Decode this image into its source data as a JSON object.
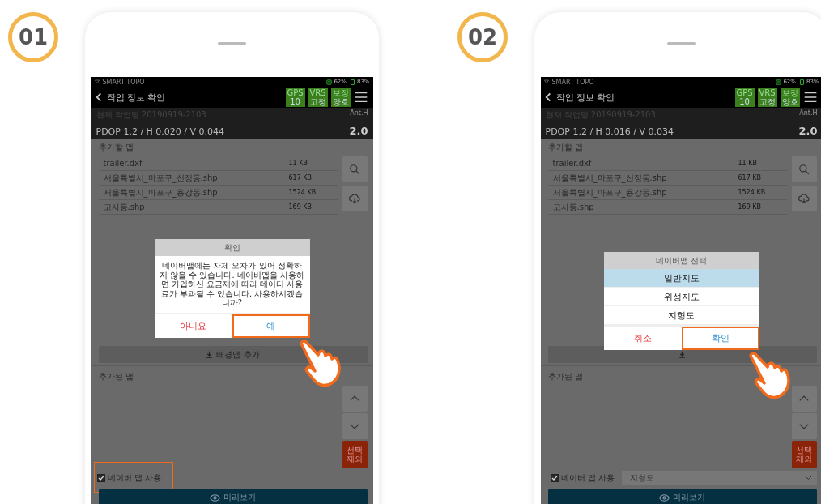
{
  "steps": [
    {
      "number": "01",
      "phone": {
        "status_bar": {
          "app_name": "SMART TOPO",
          "signal": "62%",
          "battery": "83%"
        },
        "header": {
          "title": "작업 정보 확인",
          "badges": [
            {
              "label": "GPS",
              "value": "10"
            },
            {
              "label": "VRS",
              "value": "고정"
            },
            {
              "label": "보정",
              "value": "양호"
            }
          ]
        },
        "info": {
          "job": "현재 작업명 20190919-2103",
          "precision": "PDOP 1.2 / H 0.020 / V 0.044",
          "ant_label": "Ant.H",
          "ant_value": "2.0"
        },
        "maps_to_add": {
          "label": "추가할 맵",
          "files": [
            {
              "name": "trailer.dxf",
              "size": "11 KB"
            },
            {
              "name": "서울특별시_마포구_신정동.shp",
              "size": "617 KB"
            },
            {
              "name": "서울특별시_마포구_용강동.shp",
              "size": "1524 KB"
            },
            {
              "name": "고사동.shp",
              "size": "169 KB"
            }
          ]
        },
        "add_background_button": "배경맵 추가",
        "added_maps": {
          "label": "추가된 맵",
          "exclude_button": "선택 제외"
        },
        "naver_checkbox": {
          "label": "네이버 맵 사용",
          "checked": true,
          "highlighted": true
        },
        "preview_button": "미리보기",
        "dialog": {
          "kind": "confirm",
          "title": "확인",
          "message": "네이버맵에는 자체 오차가 있어 정확하지 않을 수 있습니다. 네이버맵을 사용하면 가입하신 요금제에 따라 데이터 사용료가 부과될 수 있습니다. 사용하시겠습니까?",
          "buttons": [
            {
              "label": "아니요",
              "kind": "cancel",
              "highlighted": false
            },
            {
              "label": "예",
              "kind": "ok",
              "highlighted": true
            }
          ]
        }
      }
    },
    {
      "number": "02",
      "phone": {
        "status_bar": {
          "app_name": "SMART TOPO",
          "signal": "62%",
          "battery": "83%"
        },
        "header": {
          "title": "작업 정보 확인",
          "badges": [
            {
              "label": "GPS",
              "value": "10"
            },
            {
              "label": "VRS",
              "value": "고정"
            },
            {
              "label": "보정",
              "value": "양호"
            }
          ]
        },
        "info": {
          "job": "현재 작업명 20190919-2103",
          "precision": "PDOP 1.2 / H 0.016 / V 0.034",
          "ant_label": "Ant.H",
          "ant_value": "2.0"
        },
        "maps_to_add": {
          "label": "추가할 맵",
          "files": [
            {
              "name": "trailer.dxf",
              "size": "11 KB"
            },
            {
              "name": "서울특별시_마포구_신정동.shp",
              "size": "617 KB"
            },
            {
              "name": "서울특별시_마포구_용강동.shp",
              "size": "1524 KB"
            },
            {
              "name": "고사동.shp",
              "size": "169 KB"
            }
          ]
        },
        "added_maps": {
          "label": "추가된 맵",
          "exclude_button": "선택 제외"
        },
        "naver_checkbox": {
          "label": "네이버 맵 사용",
          "checked": true,
          "highlighted": false
        },
        "map_type_dropdown": "지형도",
        "preview_button": "미리보기",
        "dialog": {
          "kind": "select",
          "title": "네이버맵 선택",
          "options": [
            {
              "label": "일반지도",
              "selected": true
            },
            {
              "label": "위성지도",
              "selected": false
            },
            {
              "label": "지형도",
              "selected": false
            }
          ],
          "buttons": [
            {
              "label": "취소",
              "kind": "cancel",
              "highlighted": false
            },
            {
              "label": "확인",
              "kind": "ok",
              "highlighted": true
            }
          ]
        }
      }
    }
  ]
}
